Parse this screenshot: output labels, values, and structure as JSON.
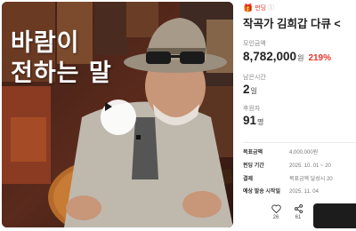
{
  "media": {
    "overlay_title_line1": "바람이",
    "overlay_title_line2": "전하는 말"
  },
  "project": {
    "badge": "펀딩",
    "title": "작곡가 김희갑 다큐 <",
    "raised_label": "모인금액",
    "raised_amount": "8,782,000",
    "raised_unit": "원",
    "raised_percent": "219%",
    "remaining_label": "남은시간",
    "remaining_value": "2",
    "remaining_unit": "일",
    "backers_label": "후원자",
    "backers_value": "91",
    "backers_unit": "명"
  },
  "details": [
    {
      "key": "목표금액",
      "value": "4,000,000원"
    },
    {
      "key": "펀딩 기간",
      "value": "2025. 10. 01 ~ 20"
    },
    {
      "key": "결제",
      "value": "목표금액 달성시 20"
    },
    {
      "key": "예상 발송 시작일",
      "value": "2025. 11. 04"
    }
  ],
  "actions": {
    "like_count": "26",
    "share_count": "61"
  },
  "colors": {
    "accent": "#e8352a",
    "cta": "#1c1c1c"
  },
  "icons": [
    "gift-icon",
    "info-icon",
    "play-icon",
    "heart-icon",
    "share-icon"
  ]
}
